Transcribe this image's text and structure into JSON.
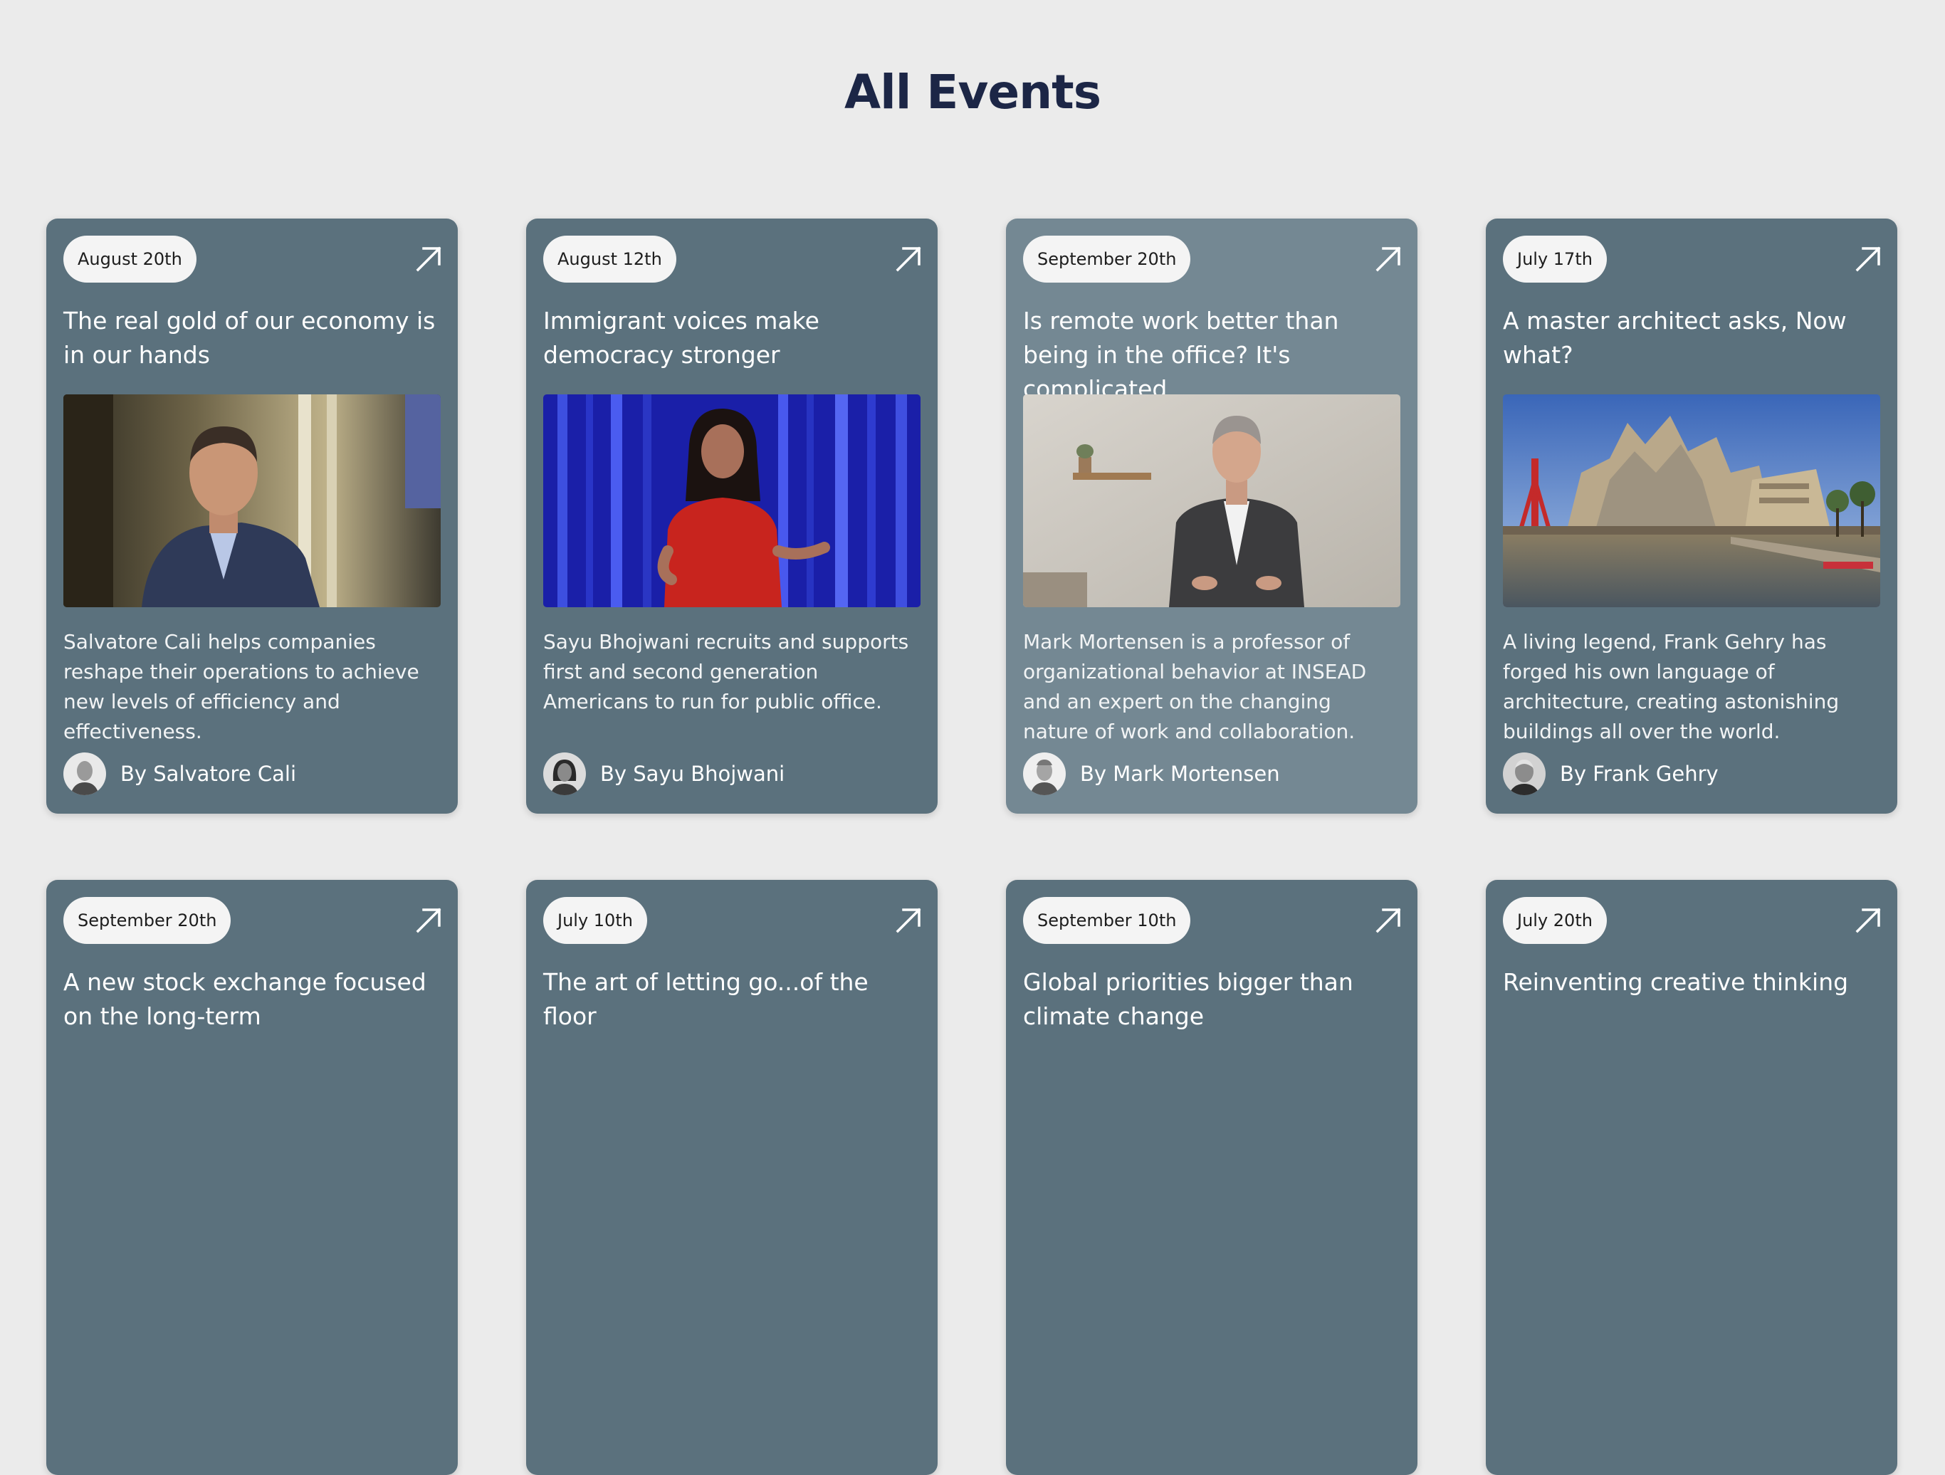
{
  "page": {
    "title": "All Events"
  },
  "icons": {
    "card_link": "arrow-up-right-icon"
  },
  "colors": {
    "background": "#ebebeb",
    "title": "#1c2646",
    "card": "#5b717d",
    "card_highlight": "#748893",
    "pill": "#f4f4f4"
  },
  "events": [
    {
      "date": "August 20th",
      "title": "The real gold of our economy is in our hands",
      "description": "Salvatore Cali helps companies reshape their operations to achieve new levels of efficiency and effectiveness.",
      "author": "By Salvatore Cali"
    },
    {
      "date": "August 12th",
      "title": "Immigrant voices make democracy stronger",
      "description": "Sayu Bhojwani recruits and supports first and second generation Americans to run for public office.",
      "author": "By Sayu Bhojwani"
    },
    {
      "date": "September 20th",
      "title": "Is remote work better than being in the office? It's complicated",
      "description": "Mark Mortensen is a professor of organizational behavior at INSEAD and an expert on the changing nature of work and collaboration.",
      "author": "By Mark Mortensen"
    },
    {
      "date": "July 17th",
      "title": "A master architect asks, Now what?",
      "description": "A living legend, Frank Gehry has forged his own language of architecture, creating astonishing buildings all over the world.",
      "author": "By Frank Gehry"
    },
    {
      "date": "September 20th",
      "title": "A new stock exchange focused on the long-term"
    },
    {
      "date": "July 10th",
      "title": "The art of letting go...of the floor"
    },
    {
      "date": "September 10th",
      "title": "Global priorities bigger than climate change"
    },
    {
      "date": "July 20th",
      "title": "Reinventing creative thinking"
    }
  ]
}
